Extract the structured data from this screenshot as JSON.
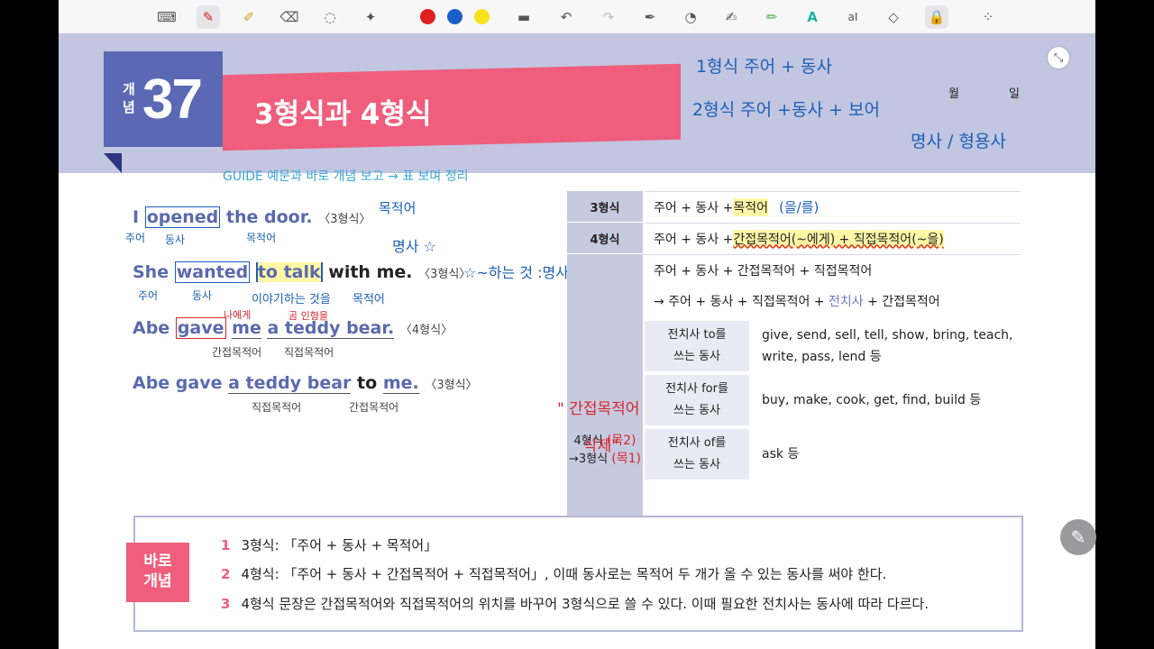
{
  "toolbar": {
    "icons": [
      "keyboard-icon",
      "pen-icon",
      "highlighter-icon",
      "eraser-icon",
      "lasso-icon",
      "magic-icon",
      "color-red",
      "color-blue",
      "color-yellow",
      "line-width-icon",
      "undo-icon",
      "redo-icon",
      "pen-settings-icon",
      "shape-icon",
      "text-pen-icon",
      "marker-icon",
      "text-icon",
      "text-box-icon",
      "shapes-icon",
      "lock-icon",
      "grid-icon"
    ],
    "colors": {
      "red": "#e02020",
      "blue": "#1a5fc8",
      "yellow": "#f5e21b"
    }
  },
  "header": {
    "concept_label": "개념",
    "concept_number": "37",
    "title": "3형식과 4형식",
    "guide": "GUIDE 예문과 바로 개념 보고 → 표 보며 정리"
  },
  "sentences": [
    {
      "w1": "I",
      "w2": "opened",
      "w3": "the door.",
      "tag": "〈3형식〉"
    },
    {
      "w1": "She",
      "w2": "wanted",
      "w3": "to talk",
      "w4": "with me.",
      "tag": "〈3형식〉"
    },
    {
      "w1": "Abe",
      "w2": "gave",
      "w3": "me",
      "w4": "a teddy bear.",
      "tag": "〈4형식〉"
    },
    {
      "w1": "Abe gave",
      "w2": "a teddy bear",
      "w3": "to",
      "w4": "me.",
      "tag": "〈3형식〉"
    }
  ],
  "sentence_notes": {
    "s3_io": "간접목적어",
    "s3_do": "직접목적어",
    "s4_do": "직접목적어",
    "s4_io": "간접목적어"
  },
  "handwriting": {
    "line1": "1형식   주어  + 동사",
    "line2": "2형식   주어   +동사   + 보어",
    "wol": "월",
    "il": "일",
    "line3": "명사 / 형용사",
    "s1_subj": "주어",
    "s1_verb": "동사",
    "s1_obj": "목적어",
    "s1_note1": "목적어",
    "s1_note2": "명사 ☆",
    "s2_subj": "주어",
    "s2_verb": "동사",
    "s2_talk": "이야기하는 것을",
    "s2_obj": "목적어",
    "s2_note": "☆~하는 것 :명사☆",
    "s3_me": "나에게",
    "s3_bear": "곰 인형을",
    "t_mok2": "(목2)",
    "t_mok1": "(목1)",
    "t_del1": "\" 간접목적어",
    "t_del2": "삭제\""
  },
  "table": {
    "row1_label": "3형식",
    "row1_text_a": "주어 + 동사 + ",
    "row1_text_b": "목적어",
    "row1_hw": "(을/를)",
    "row2_label": "4형식",
    "row2_text_a": "주어 + 동사 + ",
    "row2_text_b": "간접목적어(~에게) + 직접목적어(~을)",
    "row3_line1": "주어 + 동사 + 간접목적어 + 직접목적어",
    "row3_line2_a": "→ 주어 + 동사 + 직접목적어 + ",
    "row3_line2_b": "전치사",
    "row3_line2_c": " + 간접목적어",
    "left_label_a": "4형식",
    "left_label_b": "→3형식",
    "sub_rows": [
      {
        "label": "전치사 to를\n쓰는 동사",
        "verbs": "give, send, sell, tell, show, bring, teach, write, pass, lend 등"
      },
      {
        "label": "전치사 for를\n쓰는 동사",
        "verbs": "buy, make, cook, get, find, build 등"
      },
      {
        "label": "전치사 of를\n쓰는 동사",
        "verbs": "ask 등"
      }
    ]
  },
  "bottom": {
    "tag": "바로\n개념",
    "items": [
      {
        "n": "1",
        "text": "3형식: 「주어 + 동사 + 목적어」"
      },
      {
        "n": "2",
        "text": "4형식: 「주어 + 동사 + 간접목적어 + 직접목적어」, 이때 동사로는 목적어 두 개가 올 수 있는 동사를 써야 한다."
      },
      {
        "n": "3",
        "text": "4형식 문장은 간접목적어와 직접목적어의 위치를 바꾸어 3형식으로 쓸 수 있다. 이때 필요한 전치사는 동사에 따라 다르다."
      }
    ]
  }
}
